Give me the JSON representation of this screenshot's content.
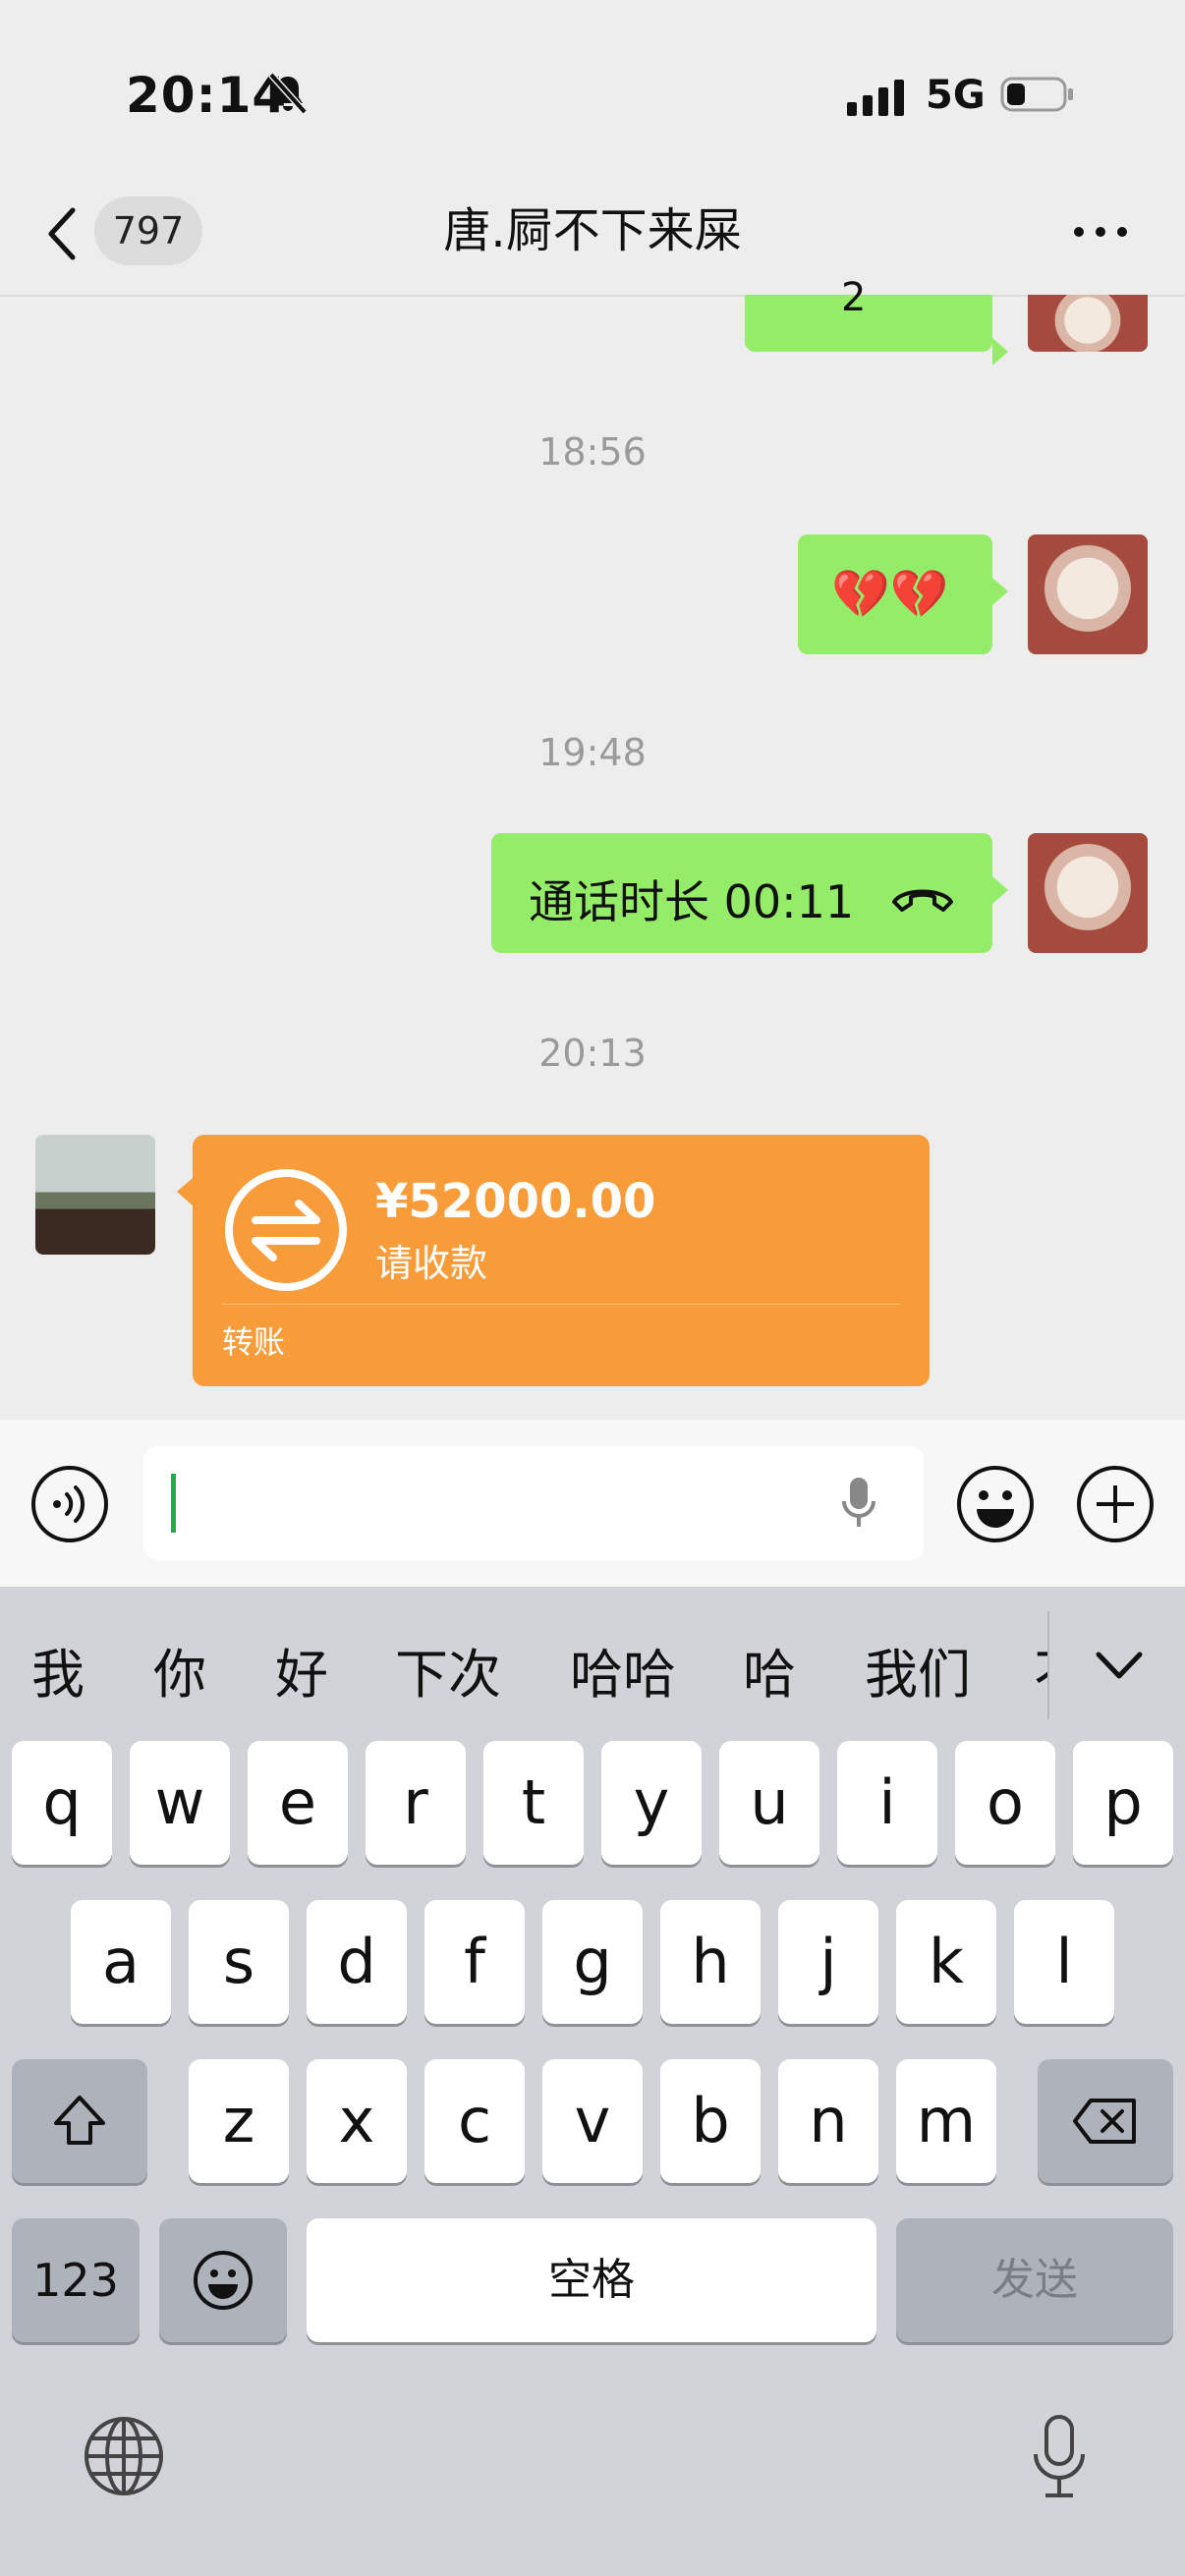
{
  "status_bar": {
    "time": "20:14",
    "network": "5G"
  },
  "nav": {
    "unread_count": "797",
    "title": "唐.屙不下来屎"
  },
  "chat": {
    "partial_top_text": "2",
    "timestamps": [
      "18:56",
      "19:48",
      "20:13"
    ],
    "emoji_message": "💔💔",
    "call_message": "通话时长 00:11",
    "transfer": {
      "amount": "¥52000.00",
      "status": "请收款",
      "label": "转账"
    }
  },
  "keyboard": {
    "candidates": [
      "我",
      "你",
      "好",
      "下次",
      "哈哈",
      "哈",
      "我们",
      "不"
    ],
    "row1": [
      "q",
      "w",
      "e",
      "r",
      "t",
      "y",
      "u",
      "i",
      "o",
      "p"
    ],
    "row2": [
      "a",
      "s",
      "d",
      "f",
      "g",
      "h",
      "j",
      "k",
      "l"
    ],
    "row3": [
      "z",
      "x",
      "c",
      "v",
      "b",
      "n",
      "m"
    ],
    "numbers_label": "123",
    "space_label": "空格",
    "send_label": "发送"
  }
}
